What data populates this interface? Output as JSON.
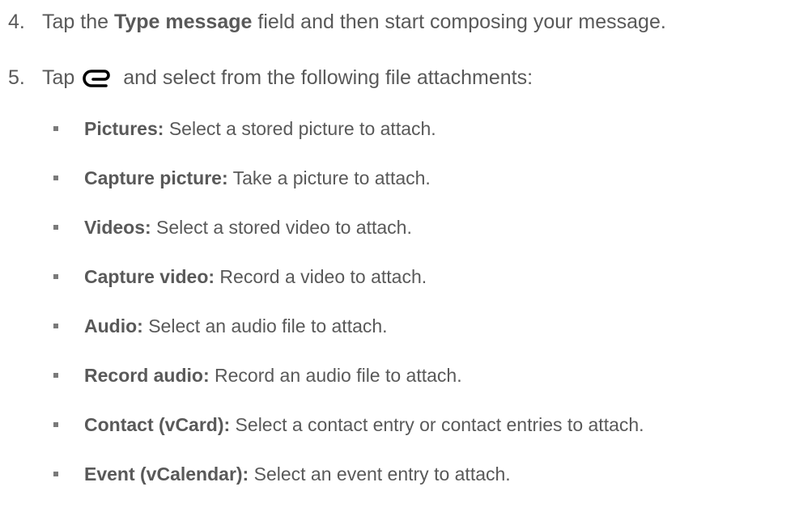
{
  "steps": [
    {
      "number": "4.",
      "pre": "Tap the ",
      "bold": "Type message",
      "post": " field and then start composing your message."
    },
    {
      "number": "5.",
      "pre": "Tap ",
      "icon": "paperclip-icon",
      "post": " and select from the following file attachments:"
    }
  ],
  "attachments": [
    {
      "name": "Pictures:",
      "desc": " Select a stored picture to attach."
    },
    {
      "name": "Capture picture:",
      "desc": " Take a picture to attach."
    },
    {
      "name": "Videos:",
      "desc": " Select a stored video to attach."
    },
    {
      "name": "Capture video:",
      "desc": " Record a video to attach."
    },
    {
      "name": "Audio:",
      "desc": " Select an audio file to attach."
    },
    {
      "name": "Record audio:",
      "desc": " Record an audio file to attach."
    },
    {
      "name": "Contact (vCard):",
      "desc": " Select a contact entry or contact entries to attach."
    },
    {
      "name": "Event (vCalendar):",
      "desc": " Select an event entry to attach."
    }
  ]
}
